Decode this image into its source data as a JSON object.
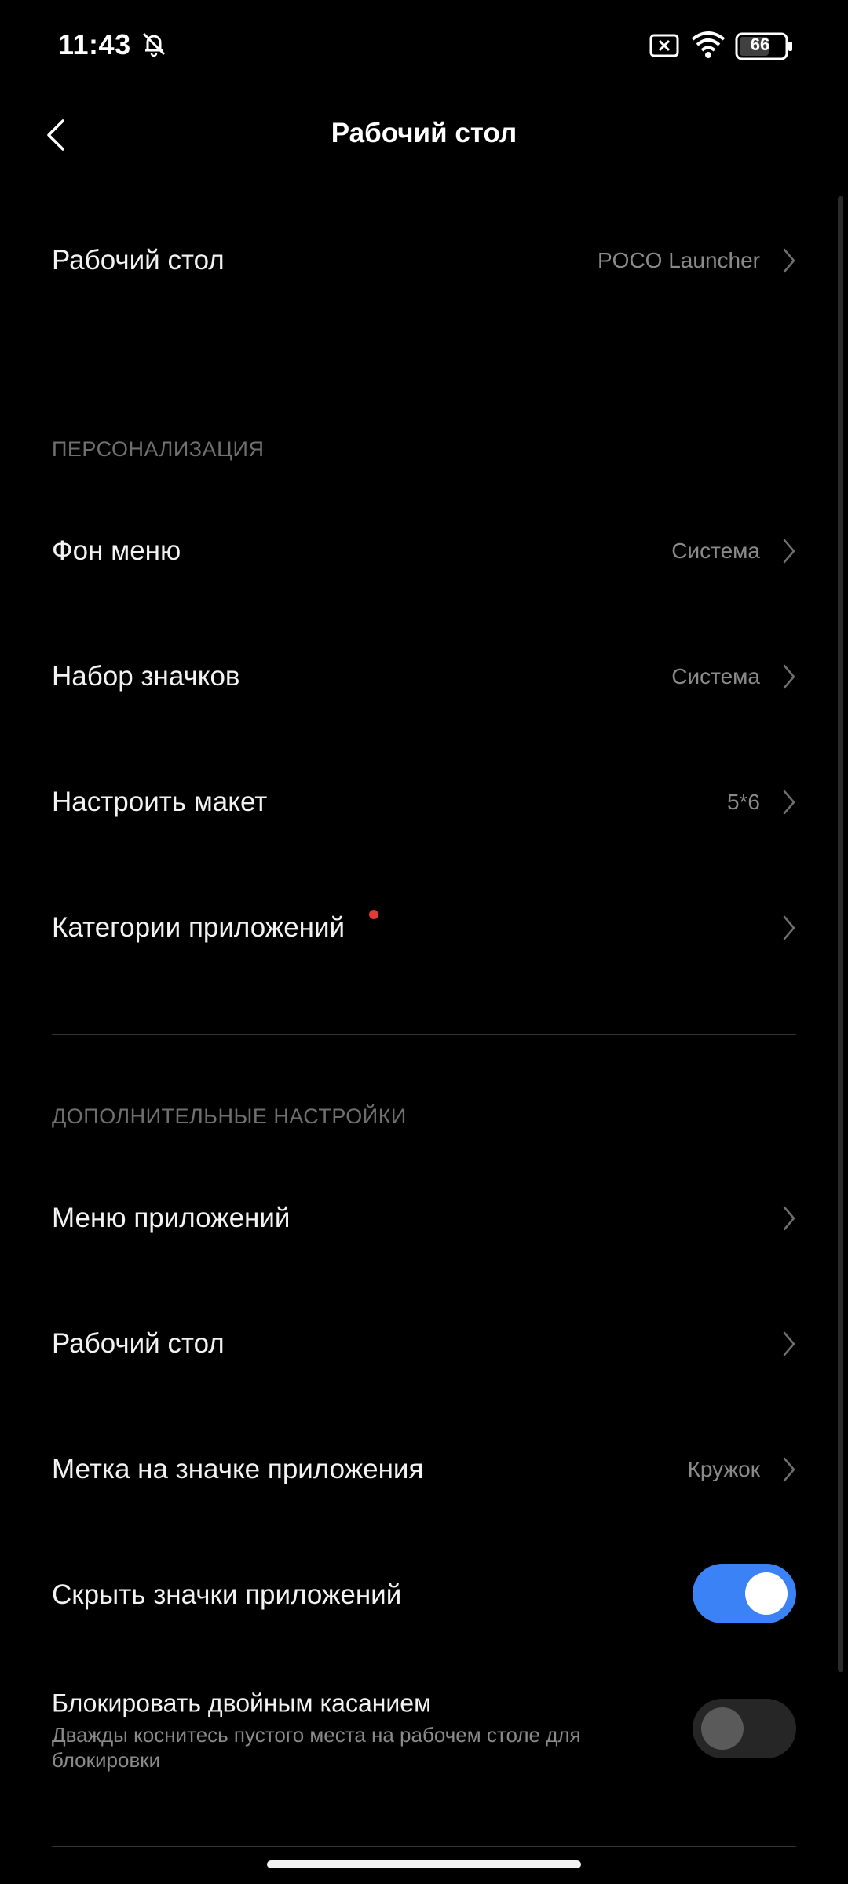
{
  "status_bar": {
    "time": "11:43",
    "battery": "66",
    "icons": [
      "muted-bell-icon",
      "no-sim-icon",
      "wifi-icon",
      "battery-icon"
    ]
  },
  "header": {
    "title": "Рабочий стол",
    "back_icon": "chevron-left-icon"
  },
  "top_item": {
    "label": "Рабочий стол",
    "value": "POCO Launcher"
  },
  "personalization": {
    "title": "ПЕРСОНАЛИЗАЦИЯ",
    "items": [
      {
        "label": "Фон меню",
        "value": "Система"
      },
      {
        "label": "Набор значков",
        "value": "Система"
      },
      {
        "label": "Настроить макет",
        "value": "5*6"
      },
      {
        "label": "Категории приложений",
        "value": ""
      }
    ]
  },
  "additional": {
    "title": "ДОПОЛНИТЕЛЬНЫЕ НАСТРОЙКИ",
    "items": [
      {
        "label": "Меню приложений",
        "value": ""
      },
      {
        "label": "Рабочий стол",
        "value": ""
      },
      {
        "label": "Метка на значке приложения",
        "value": "Кружок"
      }
    ]
  },
  "toggles": {
    "hide_icons": {
      "label": "Скрыть значки приложений",
      "on": true
    },
    "double_tap_lock": {
      "label": "Блокировать двойным касанием",
      "description": "Дважды коснитесь пустого места на рабочем столе для блокировки",
      "on": false
    }
  },
  "colors": {
    "accent": "#3b82f6",
    "badge": "#e53935",
    "background": "#000000"
  }
}
